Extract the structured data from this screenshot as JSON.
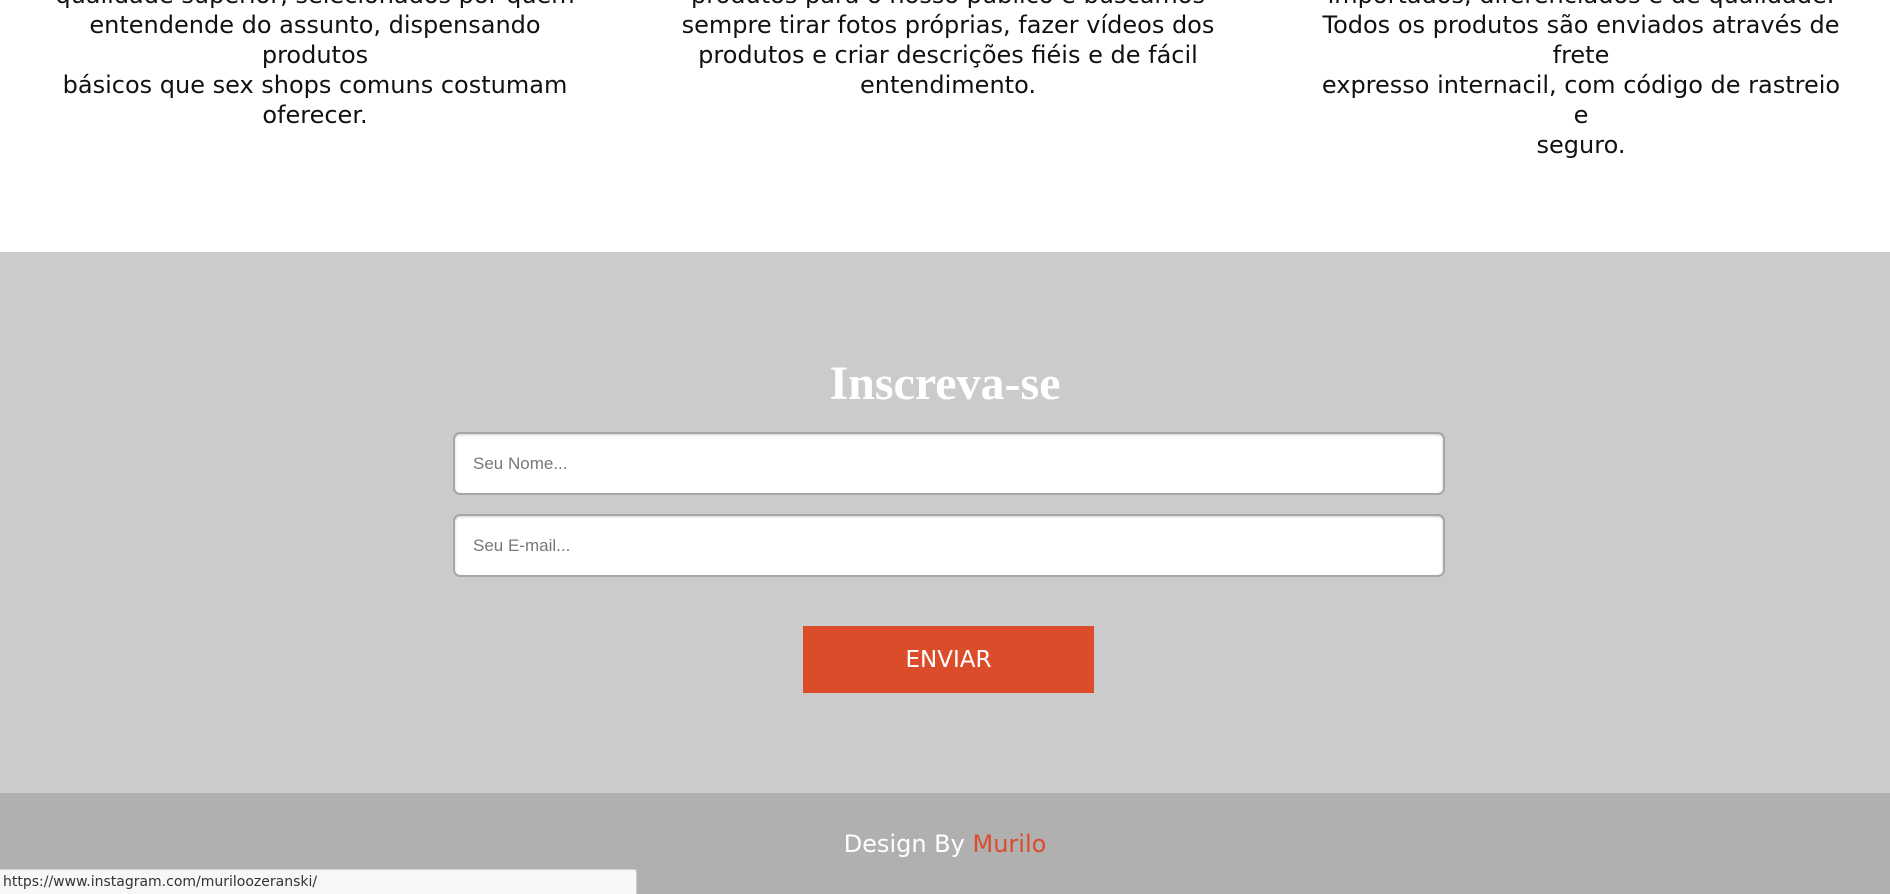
{
  "features": [
    {
      "lines": [
        "qualidade superior, selecionados por quem",
        "entendende do assunto, dispensando produtos",
        "básicos que sex shops comuns costumam",
        "oferecer."
      ]
    },
    {
      "lines": [
        "produtos para o nosso público e buscamos",
        "sempre tirar fotos próprias, fazer vídeos dos",
        "produtos e criar descrições fiéis e de fácil",
        "entendimento."
      ]
    },
    {
      "lines": [
        "importados, diferenciados e de qualidade.",
        "Todos os produtos são enviados através de frete",
        "expresso internacil, com código de rastreio e",
        "seguro."
      ]
    }
  ],
  "subscribe": {
    "title": "Inscreva-se",
    "name_placeholder": "Seu Nome...",
    "name_value": "",
    "email_placeholder": "Seu E-mail...",
    "email_value": "",
    "button_label": "ENVIAR"
  },
  "footer": {
    "prefix": "Design By",
    "author": "Murilo"
  },
  "status_bar": {
    "url": "https://www.instagram.com/muriloozeranski/"
  },
  "colors": {
    "accent": "#db4c2b",
    "subscribe_bg": "#cbcbcb",
    "footer_bg": "#b0b0b0"
  }
}
